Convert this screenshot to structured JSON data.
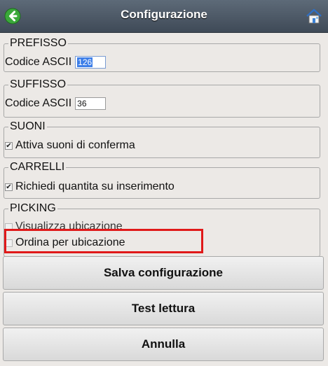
{
  "header": {
    "title": "Configurazione",
    "back_icon": "back-arrow-icon",
    "home_icon": "home-icon",
    "accent": "#4a5562"
  },
  "prefisso": {
    "legend": "PREFISSO",
    "label": "Codice ASCII",
    "value": "126"
  },
  "suffisso": {
    "legend": "SUFFISSO",
    "label": "Codice ASCII",
    "value": "36"
  },
  "suoni": {
    "legend": "SUONI",
    "checkbox_label": "Attiva suoni di conferma",
    "checked": true
  },
  "carrelli": {
    "legend": "CARRELLI",
    "checkbox_label": "Richiedi quantita su inserimento",
    "checked": true
  },
  "picking": {
    "legend": "PICKING",
    "items": [
      {
        "label": "Visualizza ubicazione",
        "checked": false
      },
      {
        "label": "Ordina per ubicazione",
        "checked": false
      }
    ]
  },
  "buttons": {
    "save": "Salva configurazione",
    "test": "Test lettura",
    "cancel": "Annulla"
  },
  "highlight_color": "#e01919"
}
